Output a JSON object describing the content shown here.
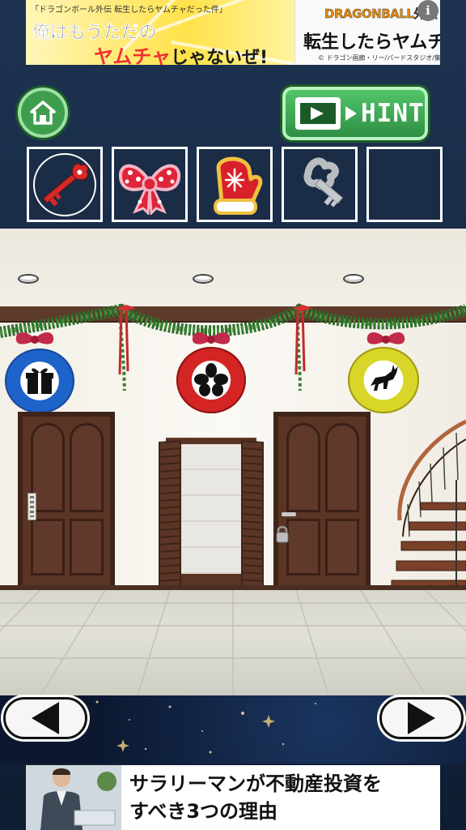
{
  "ad_top": {
    "caption": "「ドラゴンボール外伝 転生したらヤムチャだった件」",
    "line1": "俺はもうただの",
    "line2_em": "ヤムチャ",
    "line2_rest": "じゃないぜ!",
    "brand": "DRAGONBALL外伝",
    "title": "転生したらヤムチャだった件",
    "copyright": "© ドラゴン画廊・リー/バードスタジオ/集英社",
    "info": "i"
  },
  "toolbar": {
    "hint_label": "HINT"
  },
  "inventory": {
    "items": [
      "red-key",
      "red-polka-dot-bow",
      "red-mitten",
      "silver-key",
      "empty"
    ]
  },
  "ad_bottom": {
    "headline_line1": "サラリーマンが不動産投資を",
    "headline_line2": "すべき3つの理由"
  }
}
